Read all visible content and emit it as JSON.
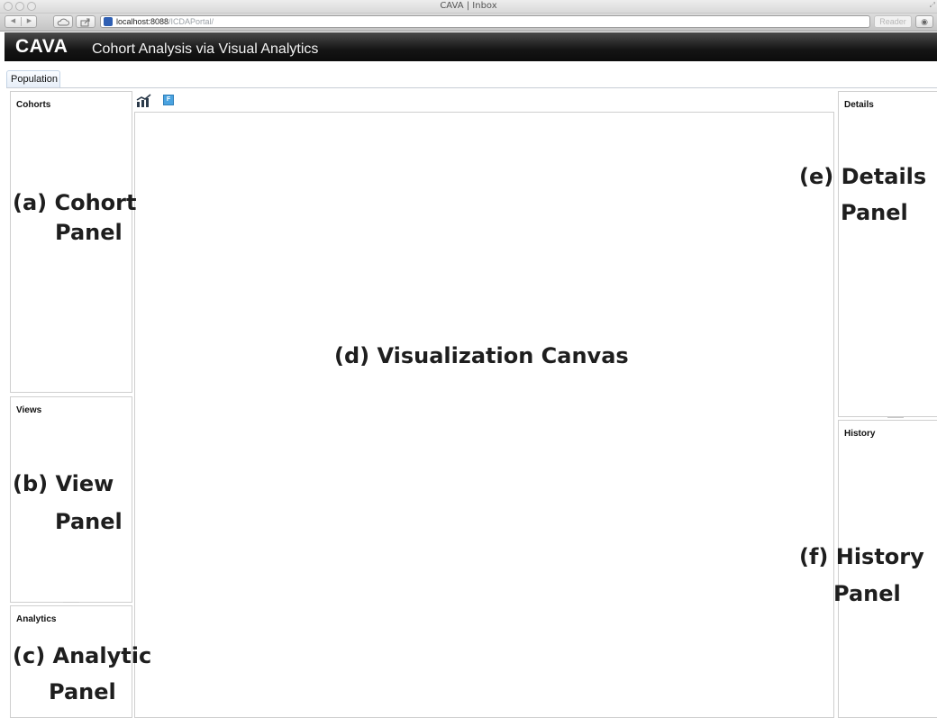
{
  "browser": {
    "window_title": "CAVA | Inbox",
    "url_host": "localhost:8088",
    "url_path": "/ICDAPortal/",
    "reader_label": "Reader"
  },
  "app": {
    "logo": "CAVA",
    "subtitle": "Cohort Analysis via Visual Analytics"
  },
  "tabs": [
    {
      "label": "Population",
      "active": true
    }
  ],
  "panels": {
    "cohorts": {
      "title": "Cohorts"
    },
    "views": {
      "title": "Views"
    },
    "analytics": {
      "title": "Analytics"
    },
    "details": {
      "title": "Details"
    },
    "history": {
      "title": "History"
    }
  },
  "toolbar": {
    "f_button_label": "F"
  },
  "annotations": {
    "a_line1": "(a) Cohort",
    "a_line2": "Panel",
    "b_line1": "(b) View",
    "b_line2": "Panel",
    "c_line1": "(c) Analytic",
    "c_line2": "Panel",
    "d": "(d) Visualization Canvas",
    "e_line1": "(e) Details",
    "e_line2": "Panel",
    "f_line1": "(f) History",
    "f_line2": "Panel"
  },
  "colors": {
    "header_bg": "#151515",
    "f_button": "#4aa3e0",
    "favicon": "#2f5fb3"
  }
}
